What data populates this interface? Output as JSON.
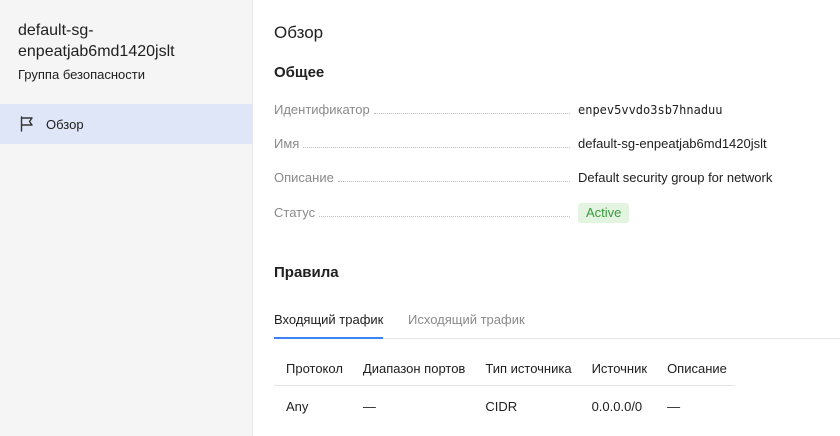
{
  "sidebar": {
    "sg_name": "default-sg-enpeatjab6md1420jslt",
    "sg_type": "Группа безопасности",
    "nav_items": [
      {
        "label": "Обзор",
        "icon": "flag-icon"
      }
    ]
  },
  "main": {
    "title": "Обзор",
    "general": {
      "title": "Общее",
      "fields": {
        "id": {
          "key": "Идентификатор",
          "value": "enpev5vvdo3sb7hnaduu"
        },
        "name": {
          "key": "Имя",
          "value": "default-sg-enpeatjab6md1420jslt"
        },
        "description": {
          "key": "Описание",
          "value": "Default security group for network"
        },
        "status": {
          "key": "Статус",
          "value": "Active"
        }
      }
    },
    "rules": {
      "title": "Правила",
      "tabs": [
        {
          "label": "Входящий трафик",
          "active": true
        },
        {
          "label": "Исходящий трафик",
          "active": false
        }
      ],
      "columns": [
        "Протокол",
        "Диапазон портов",
        "Тип источника",
        "Источник",
        "Описание"
      ],
      "rows": [
        [
          "Any",
          "—",
          "CIDR",
          "0.0.0.0/0",
          "—"
        ]
      ]
    }
  },
  "colors": {
    "nav_active_bg": "#dfe6f7",
    "status_badge_bg": "#e3f4e0",
    "status_badge_text": "#3a9a3f",
    "tab_active_underline": "#3b82f6"
  }
}
